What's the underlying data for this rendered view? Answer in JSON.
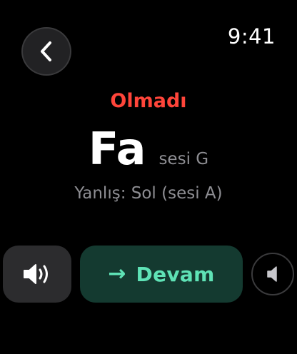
{
  "status_bar": {
    "time": "9:41"
  },
  "navigation": {
    "back_icon": "chevron-left-icon"
  },
  "feedback": {
    "result": "Olmadı",
    "note_name": "Fa",
    "note_letter": "sesi G",
    "wrong_answer": "Yanlış: Sol (sesi A)"
  },
  "actions": {
    "play_icon": "speaker-wave-icon",
    "continue_arrow": "→",
    "continue_label": "Devam",
    "volume_icon": "speaker-icon"
  },
  "colors": {
    "error": "#ff453a",
    "accent": "#5fe3b6",
    "accent_bg": "#143a30",
    "secondary_text": "#8e8e93"
  }
}
